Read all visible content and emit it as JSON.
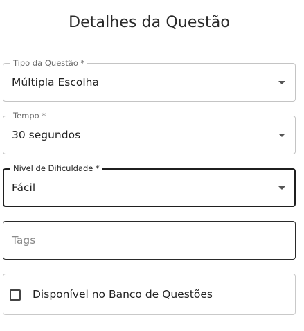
{
  "title": "Detalhes da Questão",
  "fields": {
    "tipo": {
      "label": "Tipo da Questão *",
      "value": "Múltipla Escolha"
    },
    "tempo": {
      "label": "Tempo *",
      "value": "30 segundos"
    },
    "nivel": {
      "label": "Nível de Dificuldade *",
      "value": "Fácil"
    },
    "tags": {
      "placeholder": "Tags"
    }
  },
  "banco": {
    "label": "Disponível no Banco de Questões",
    "checked": false
  },
  "icons": {
    "dropdown": "caret-down-icon",
    "checkbox": "checkbox-unchecked-icon"
  }
}
